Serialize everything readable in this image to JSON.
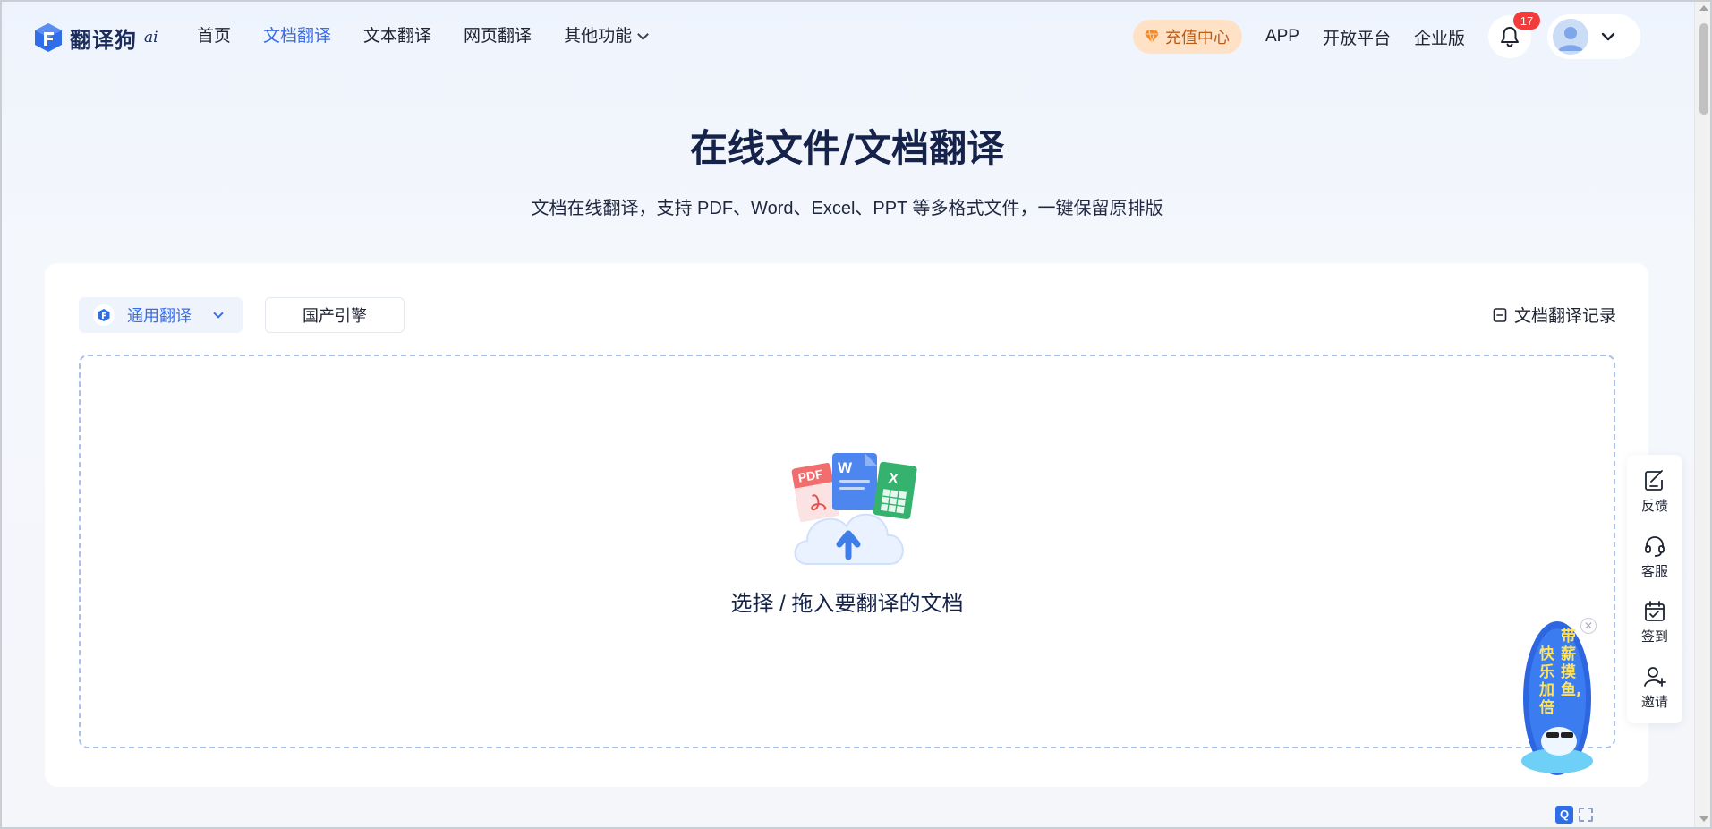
{
  "brand": {
    "name": "翻译狗",
    "suffix": "ai"
  },
  "nav": {
    "items": [
      {
        "label": "首页",
        "active": false
      },
      {
        "label": "文档翻译",
        "active": true
      },
      {
        "label": "文本翻译",
        "active": false
      },
      {
        "label": "网页翻译",
        "active": false
      },
      {
        "label": "其他功能",
        "active": false,
        "dropdown": true
      }
    ],
    "recharge_label": "充值中心",
    "app_label": "APP",
    "open_platform_label": "开放平台",
    "enterprise_label": "企业版",
    "notification_count": "17"
  },
  "hero": {
    "title": "在线文件/文档翻译",
    "subtitle": "文档在线翻译，支持 PDF、Word、Excel、PPT 等多格式文件，一键保留原排版"
  },
  "card": {
    "engine_selected": "通用翻译",
    "engine_alt": "国产引擎",
    "history_label": "文档翻译记录",
    "drop_text": "选择 / 拖入要翻译的文档",
    "file_icons": {
      "pdf": "PDF",
      "word": "W",
      "excel": "X"
    }
  },
  "side_tools": [
    {
      "label": "反馈",
      "icon": "feedback-icon"
    },
    {
      "label": "客服",
      "icon": "headset-icon"
    },
    {
      "label": "签到",
      "icon": "calendar-check-icon"
    },
    {
      "label": "邀请",
      "icon": "add-user-icon"
    }
  ],
  "promo": {
    "line1": "带薪摸鱼,",
    "line2": "快乐加倍"
  },
  "colors": {
    "accent": "#3a6ee8",
    "recharge_bg": "#ffe2c6",
    "recharge_text": "#b95a16",
    "badge": "#f23b3b"
  }
}
